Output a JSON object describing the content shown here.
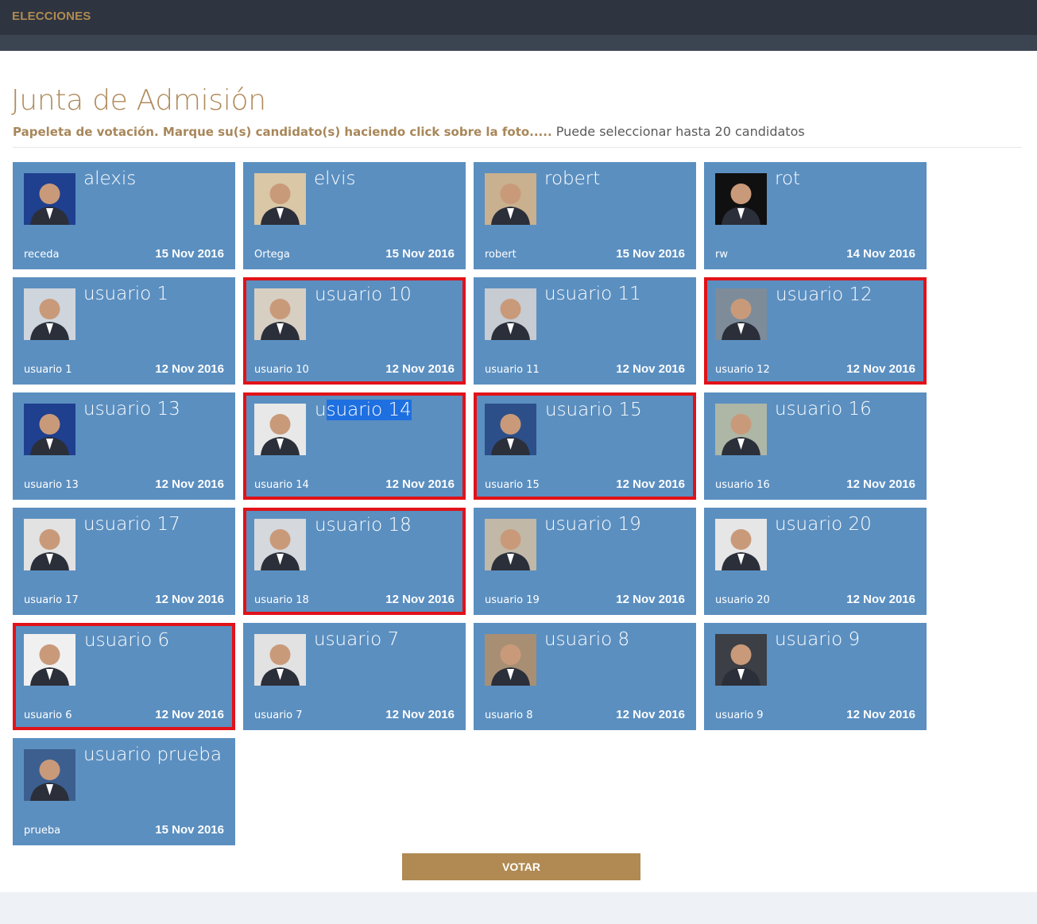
{
  "app": {
    "brand": "ELECCIONES"
  },
  "header": {
    "title": "Junta de Admisión",
    "instruction_strong": "Papeleta de votación. Marque su(s) candidato(s) haciendo click sobre la foto.....",
    "instruction_muted": "Puede seleccionar hasta 20 candidatos"
  },
  "candidates": [
    {
      "name": "alexis",
      "handle": "receda",
      "date": "15 Nov 2016",
      "selected": false
    },
    {
      "name": "elvis",
      "handle": "Ortega",
      "date": "15 Nov 2016",
      "selected": false
    },
    {
      "name": "robert",
      "handle": "robert",
      "date": "15 Nov 2016",
      "selected": false
    },
    {
      "name": "rot",
      "handle": "rw",
      "date": "14 Nov 2016",
      "selected": false
    },
    {
      "name": "usuario 1",
      "handle": "usuario 1",
      "date": "12 Nov 2016",
      "selected": false
    },
    {
      "name": "usuario 10",
      "handle": "usuario 10",
      "date": "12 Nov 2016",
      "selected": true
    },
    {
      "name": "usuario 11",
      "handle": "usuario 11",
      "date": "12 Nov 2016",
      "selected": false
    },
    {
      "name": "usuario 12",
      "handle": "usuario 12",
      "date": "12 Nov 2016",
      "selected": true
    },
    {
      "name": "usuario 13",
      "handle": "usuario 13",
      "date": "12 Nov 2016",
      "selected": false
    },
    {
      "name": "usuario 14",
      "handle": "usuario 14",
      "date": "12 Nov 2016",
      "selected": true,
      "highlight": "suario 14"
    },
    {
      "name": "usuario 15",
      "handle": "usuario 15",
      "date": "12 Nov 2016",
      "selected": true
    },
    {
      "name": "usuario 16",
      "handle": "usuario 16",
      "date": "12 Nov 2016",
      "selected": false
    },
    {
      "name": "usuario 17",
      "handle": "usuario 17",
      "date": "12 Nov 2016",
      "selected": false
    },
    {
      "name": "usuario 18",
      "handle": "usuario 18",
      "date": "12 Nov 2016",
      "selected": true
    },
    {
      "name": "usuario 19",
      "handle": "usuario 19",
      "date": "12 Nov 2016",
      "selected": false
    },
    {
      "name": "usuario 20",
      "handle": "usuario 20",
      "date": "12 Nov 2016",
      "selected": false
    },
    {
      "name": "usuario 6",
      "handle": "usuario 6",
      "date": "12 Nov 2016",
      "selected": true
    },
    {
      "name": "usuario 7",
      "handle": "usuario 7",
      "date": "12 Nov 2016",
      "selected": false
    },
    {
      "name": "usuario 8",
      "handle": "usuario 8",
      "date": "12 Nov 2016",
      "selected": false
    },
    {
      "name": "usuario 9",
      "handle": "usuario 9",
      "date": "12 Nov 2016",
      "selected": false
    },
    {
      "name": "usuario prueba",
      "handle": "prueba",
      "date": "15 Nov 2016",
      "selected": false
    }
  ],
  "photo_colors": [
    "#1f3f8f",
    "#d9c7a5",
    "#c9b08f",
    "#101010",
    "#cfd5dc",
    "#d8cfc3",
    "#c7cbd2",
    "#7e8c99",
    "#1f3f8f",
    "#e8e8e8",
    "#2c4f8a",
    "#aeb6a6",
    "#e2e2e2",
    "#d5d8dc",
    "#c2b8a8",
    "#e6e6e6",
    "#f0f0f0",
    "#e2e2e2",
    "#a88f74",
    "#3c3f45",
    "#3d5f8f"
  ],
  "actions": {
    "vote_label": "VOTAR"
  }
}
